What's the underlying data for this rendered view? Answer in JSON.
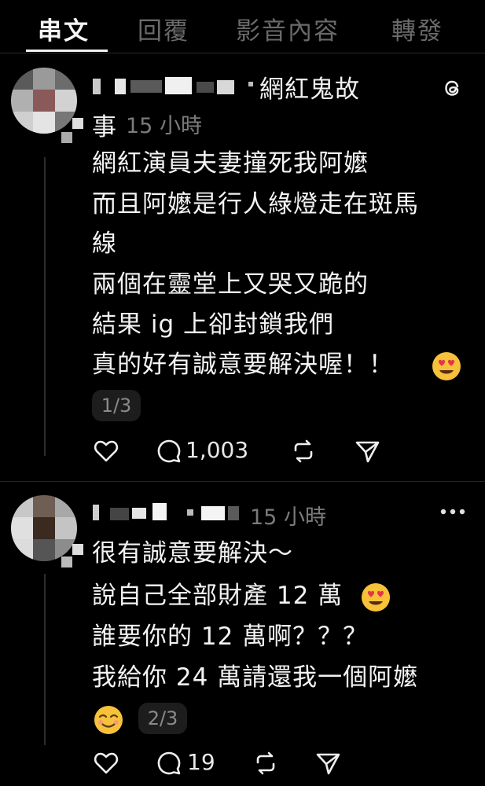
{
  "tabs": [
    "串文",
    "回覆",
    "影音內容",
    "轉發"
  ],
  "post1": {
    "title_a": "網紅鬼故",
    "title_b": "事",
    "time": "15 小時",
    "lines": [
      "網紅演員夫妻撞死我阿嬤",
      "而且阿嬤是行人綠燈走在斑馬",
      "線",
      "兩個在靈堂上又哭又跪的",
      "結果 ig 上卻封鎖我們",
      "真的好有誠意要解決喔！！"
    ],
    "page": "1/3",
    "replies": "1,003",
    "end_emoji": "heart-eyes"
  },
  "post2": {
    "time": "15 小時",
    "lines": [
      "很有誠意要解決～",
      "說自己全部財產 12 萬",
      "誰要你的 12 萬啊？？？",
      "我給你 24 萬請還我一個阿嬤"
    ],
    "page": "2/3",
    "replies": "19",
    "emojis": [
      "heart-eyes",
      "smiling"
    ]
  },
  "colors": {
    "background": "#000000",
    "text": "#f3f3f3",
    "muted": "#7b7b7b"
  }
}
